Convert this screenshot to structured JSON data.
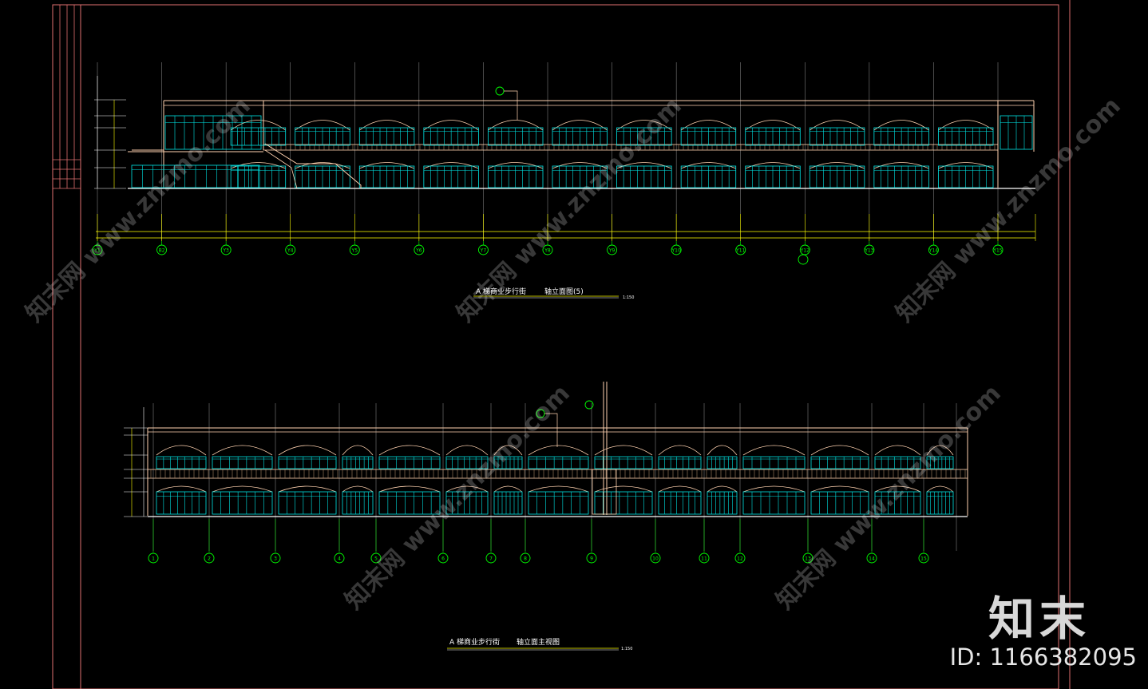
{
  "drawing_1": {
    "title_left": "A 梯商业步行街",
    "title_right": "轴立面图(5)",
    "scale": "1:150",
    "axis_labels": [
      "Y1",
      "B2",
      "Y3",
      "Y4",
      "Y5",
      "Y6",
      "Y7",
      "Y8",
      "Y9",
      "Y10",
      "Y11",
      "Y12",
      "Y13",
      "Y14",
      "Y15"
    ]
  },
  "drawing_2": {
    "title_left": "A 梯商业步行街",
    "title_right": "轴立面主视图",
    "scale": "1:150",
    "axis_labels": [
      "1",
      "2",
      "3",
      "4",
      "5",
      "6",
      "7",
      "8",
      "9",
      "10",
      "11",
      "12",
      "13",
      "14",
      "15"
    ]
  },
  "watermark_text": "知末网 www.znzmo.com",
  "brand": "知末",
  "id_label": "ID: 1166382095",
  "colors": {
    "frame": "#e07070",
    "outline": "#ffd2b0",
    "glass": "#00e5e5",
    "dim": "#ffff00",
    "axis": "#00ff00",
    "leader": "#ff80ff"
  }
}
